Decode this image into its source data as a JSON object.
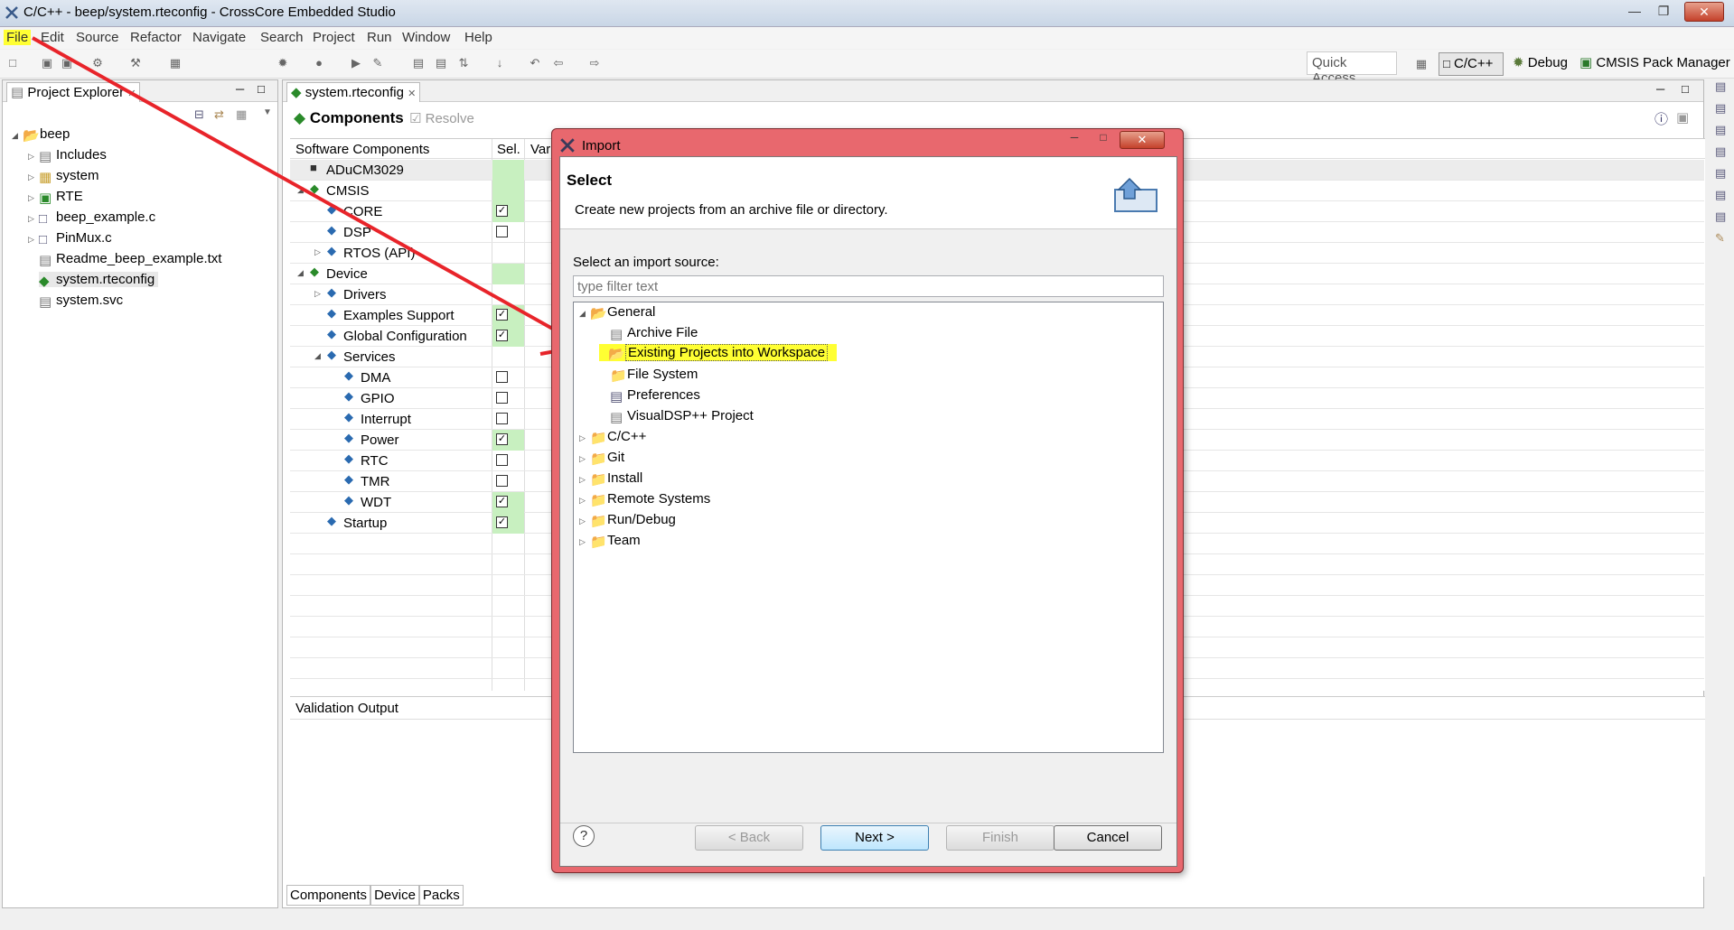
{
  "window": {
    "title": "C/C++ - beep/system.rteconfig - CrossCore Embedded Studio"
  },
  "menu": [
    "File",
    "Edit",
    "Source",
    "Refactor",
    "Navigate",
    "Search",
    "Project",
    "Run",
    "Window",
    "Help"
  ],
  "toolbar": {
    "quick_access": "Quick Access",
    "perspectives": [
      "C/C++",
      "Debug",
      "CMSIS Pack Manager"
    ]
  },
  "explorer": {
    "tab": "Project Explorer",
    "root": "beep",
    "items": [
      "Includes",
      "system",
      "RTE",
      "beep_example.c",
      "PinMux.c",
      "Readme_beep_example.txt",
      "system.rteconfig",
      "system.svc"
    ]
  },
  "editor": {
    "tab": "system.rteconfig",
    "heading": "Components",
    "resolve": "Resolve",
    "col_components": "Software Components",
    "col_sel": "Sel.",
    "col_var": "Var",
    "rows": [
      {
        "label": "ADuCM3029",
        "indent": 0,
        "sel": ""
      },
      {
        "label": "CMSIS",
        "indent": 0,
        "sel": ""
      },
      {
        "label": "CORE",
        "indent": 1,
        "sel": "checked"
      },
      {
        "label": "DSP",
        "indent": 1,
        "sel": "empty"
      },
      {
        "label": "RTOS (API)",
        "indent": 1,
        "sel": ""
      },
      {
        "label": "Device",
        "indent": 0,
        "sel": ""
      },
      {
        "label": "Drivers",
        "indent": 1,
        "sel": ""
      },
      {
        "label": "Examples Support",
        "indent": 1,
        "sel": "checked"
      },
      {
        "label": "Global Configuration",
        "indent": 1,
        "sel": "checked"
      },
      {
        "label": "Services",
        "indent": 1,
        "sel": ""
      },
      {
        "label": "DMA",
        "indent": 2,
        "sel": "empty"
      },
      {
        "label": "GPIO",
        "indent": 2,
        "sel": "empty"
      },
      {
        "label": "Interrupt",
        "indent": 2,
        "sel": "empty"
      },
      {
        "label": "Power",
        "indent": 2,
        "sel": "checked"
      },
      {
        "label": "RTC",
        "indent": 2,
        "sel": "empty"
      },
      {
        "label": "TMR",
        "indent": 2,
        "sel": "empty"
      },
      {
        "label": "WDT",
        "indent": 2,
        "sel": "checked"
      },
      {
        "label": "Startup",
        "indent": 1,
        "sel": "checked"
      }
    ],
    "validation": "Validation Output",
    "bottom_tabs": [
      "Components",
      "Device",
      "Packs"
    ]
  },
  "dialog": {
    "title": "Import",
    "heading": "Select",
    "description": "Create new projects from an archive file or directory.",
    "source_label": "Select an import source:",
    "filter_placeholder": "type filter text",
    "general": "General",
    "general_items": [
      "Archive File",
      "Existing Projects into Workspace",
      "File System",
      "Preferences",
      "VisualDSP++ Project"
    ],
    "categories": [
      "C/C++",
      "Git",
      "Install",
      "Remote Systems",
      "Run/Debug",
      "Team"
    ],
    "buttons": {
      "back": "< Back",
      "next": "Next >",
      "finish": "Finish",
      "cancel": "Cancel"
    }
  }
}
